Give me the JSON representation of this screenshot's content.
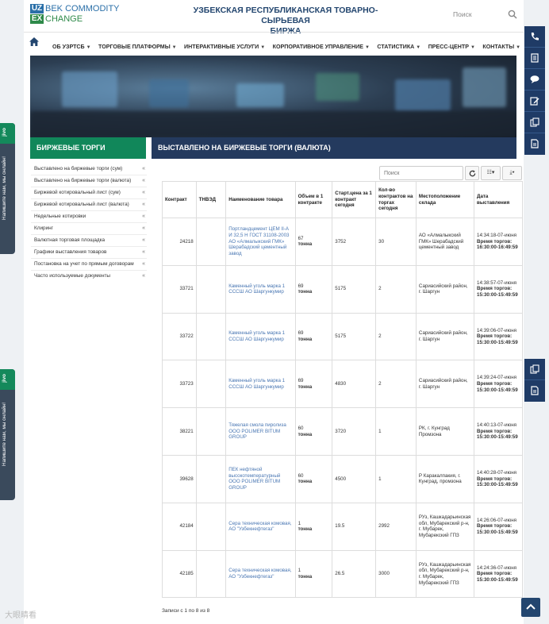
{
  "logo": {
    "uz": "UZ",
    "ex": "EX",
    "line1": "BEK COMMODITY",
    "line2": "CHANGE"
  },
  "header": {
    "title_line1": "УЗБЕКСКАЯ РЕСПУБЛИКАНСКАЯ ТОВАРНО-СЫРЬЕВАЯ",
    "title_line2": "БИРЖА",
    "search_label": "Поиск"
  },
  "nav": {
    "items": [
      {
        "label": "ОБ УЗРТСБ"
      },
      {
        "label": "ТОРГОВЫЕ ПЛАТФОРМЫ"
      },
      {
        "label": "ИНТЕРАКТИВНЫЕ УСЛУГИ"
      },
      {
        "label": "КОРПОРАТИВНОЕ УПРАВЛЕНИЕ"
      },
      {
        "label": "СТАТИСТИКА"
      },
      {
        "label": "ПРЕСС-ЦЕНТР"
      },
      {
        "label": "КОНТАКТЫ"
      }
    ]
  },
  "section": {
    "left_title": "БИРЖЕВЫЕ ТОРГИ",
    "right_title": "ВЫСТАВЛЕНО НА БИРЖЕВЫЕ ТОРГИ (ВАЛЮТА)"
  },
  "sidebar": {
    "items": [
      {
        "label": "Выставлено на биржевые торги (сум)"
      },
      {
        "label": "Выставлено на биржевые торги (валюта)"
      },
      {
        "label": "Биржевой котировальный лист (сум)"
      },
      {
        "label": "Биржевой котировальный лист (валюта)"
      },
      {
        "label": "Недельные котировки"
      },
      {
        "label": "Клиринг"
      },
      {
        "label": "Валютная торговая площадка"
      },
      {
        "label": "Графики выставления товаров"
      },
      {
        "label": "Постановка на учет по прямым договорам"
      },
      {
        "label": "Часто используемые документы"
      }
    ]
  },
  "toolbar": {
    "search_placeholder": "Поиск"
  },
  "table": {
    "headers": [
      "Контракт",
      "ТНВЭД",
      "Наименование товара",
      "Объем в 1 контракте",
      "Старт.цена за 1 контракт сегодня",
      "Кол-во контрактов на торгах сегодня",
      "Местоположение склада",
      "Дата выставления"
    ],
    "rows": [
      {
        "contract": "24218",
        "tnved": "",
        "name": "Портландцемент ЦЕМ II-А И 32,5 Н ГОСТ 31108-2003 АО «Алмалыкский ГМК» Шерабадский цементный завод",
        "vol_num": "67",
        "vol_unit": "тонна",
        "price": "3752",
        "qty": "30",
        "location": "АО «Алмалыкский ГМК» Шерабадский цементный завод",
        "date": "14:34:18-07-июня",
        "time_label": "Время торгов:",
        "time_value": "16:30:00-16:49:59"
      },
      {
        "contract": "33721",
        "tnved": "",
        "name": "Каменный уголь марка 1 СССШ АО Шаргункумир",
        "vol_num": "69",
        "vol_unit": "тонна",
        "price": "5175",
        "qty": "2",
        "location": "Сариасийский район, г. Шаргун",
        "date": "14:38:57-07-июня",
        "time_label": "Время торгов:",
        "time_value": "15:30:00-15:49:59"
      },
      {
        "contract": "33722",
        "tnved": "",
        "name": "Каменный уголь марка 1 СССШ АО Шаргункумир",
        "vol_num": "69",
        "vol_unit": "тонна",
        "price": "5175",
        "qty": "2",
        "location": "Сариасийский район, г. Шаргун",
        "date": "14:39:06-07-июня",
        "time_label": "Время торгов:",
        "time_value": "15:30:00-15:49:59"
      },
      {
        "contract": "33723",
        "tnved": "",
        "name": "Каменный уголь марка 1 СССШ АО Шаргункумир",
        "vol_num": "69",
        "vol_unit": "тонна",
        "price": "4830",
        "qty": "2",
        "location": "Сариасийский район, г. Шаргун",
        "date": "14:39:24-07-июня",
        "time_label": "Время торгов:",
        "time_value": "15:30:00-15:49:59"
      },
      {
        "contract": "38221",
        "tnved": "",
        "name": "Тяжелая смола пиролиза ООО POLIMER BITUM GROUP",
        "vol_num": "60",
        "vol_unit": "тонна",
        "price": "3720",
        "qty": "1",
        "location": "РК, г. Кунград Промзона",
        "date": "14:40:13-07-июня",
        "time_label": "Время торгов:",
        "time_value": "15:30:00-15:49:59"
      },
      {
        "contract": "39628",
        "tnved": "",
        "name": "ПЕК нефтяной высокотемпературный ООО POLIMER BITUM GROUP",
        "vol_num": "60",
        "vol_unit": "тонна",
        "price": "4500",
        "qty": "1",
        "location": "Р Каракалпакия, г. Кунград, промзона",
        "date": "14:40:28-07-июня",
        "time_label": "Время торгов:",
        "time_value": "15:30:00-15:49:59"
      },
      {
        "contract": "42184",
        "tnved": "",
        "name": "Сера техническая комовая, АО \"Узбекнефтегаз\"",
        "vol_num": "1",
        "vol_unit": "тонна",
        "price": "19.5",
        "qty": "2992",
        "location": "РУз, Кашкадарьинская обл, Мубарекский р-н, г. Мубарек, Мубарекский ГПЗ",
        "date": "14:26:06-07-июня",
        "time_label": "Время торгов:",
        "time_value": "15:30:00-15:49:59"
      },
      {
        "contract": "42185",
        "tnved": "",
        "name": "Сера техническая комовая, АО \"Узбекнефтегаз\"",
        "vol_num": "1",
        "vol_unit": "тонна",
        "price": "26.5",
        "qty": "3000",
        "location": "РУз, Кашкадарьинская обл, Мубарекский р-н, г. Мубарек, Мубарекский ГПЗ",
        "date": "14:24:36-07-июня",
        "time_label": "Время торгов:",
        "time_value": "15:30:00-15:49:59"
      }
    ]
  },
  "footer": {
    "records_text": "Записи с 1 по 8 из 8"
  },
  "chat_tab": {
    "label": "Напишите нам, мы онлайн!",
    "brand": "jivo"
  },
  "watermark": "大眼睛看",
  "colors": {
    "green": "#11875a",
    "navy": "#243a5e",
    "link": "#4a77b3"
  },
  "icons": [
    "home-icon",
    "search-icon",
    "refresh-icon",
    "columns-icon",
    "export-icon",
    "phone-icon",
    "document-icon",
    "chat-icon",
    "edit-icon",
    "pages-icon",
    "file-icon",
    "arrow-up-icon"
  ]
}
